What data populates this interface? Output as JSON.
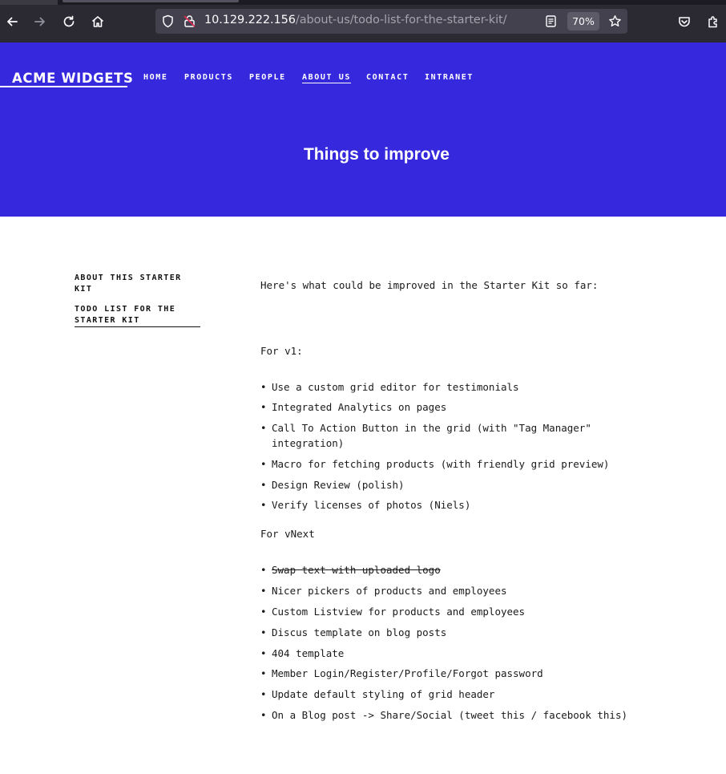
{
  "browser": {
    "url_host": "10.129.222.156",
    "url_path": "/about-us/todo-list-for-the-starter-kit/",
    "zoom": "70%",
    "icons": [
      "back-icon",
      "forward-icon",
      "reload-icon",
      "home-icon",
      "shield-icon",
      "insecure-lock-icon",
      "reader-view-icon",
      "bookmark-star-icon",
      "pocket-icon",
      "extensions-icon"
    ]
  },
  "site": {
    "logo": "ACME WIDGETS",
    "nav": [
      "HOME",
      "PRODUCTS",
      "PEOPLE",
      "ABOUT US",
      "CONTACT",
      "INTRANET"
    ],
    "active_nav": "ABOUT US",
    "page_title": "Things to improve",
    "brand_color": "#3628dd"
  },
  "sidebar": {
    "items": [
      {
        "label": "ABOUT THIS STARTER KIT",
        "active": false
      },
      {
        "label": "TODO LIST FOR THE STARTER KIT",
        "active": true
      }
    ]
  },
  "content": {
    "intro": "Here's what could be improved in the Starter Kit so far:",
    "v1_heading": "For v1:",
    "v1_items": [
      {
        "text": "Use a custom grid editor for testimonials",
        "done": false
      },
      {
        "text": "Integrated Analytics on pages",
        "done": false
      },
      {
        "text": "Call To Action Button in the grid (with \"Tag Manager\" integration)",
        "done": false
      },
      {
        "text": "Macro for fetching products (with friendly grid preview)",
        "done": false
      },
      {
        "text": "Design Review (polish)",
        "done": false
      },
      {
        "text": "Verify licenses of photos (Niels)",
        "done": false
      }
    ],
    "vnext_heading": "For vNext",
    "vnext_items": [
      {
        "text": "Swap text with uploaded logo",
        "done": true
      },
      {
        "text": "Nicer pickers of products and employees",
        "done": false
      },
      {
        "text": "Custom Listview for products and employees",
        "done": false
      },
      {
        "text": "Discus template on blog posts",
        "done": false
      },
      {
        "text": "404 template",
        "done": false
      },
      {
        "text": "Member Login/Register/Profile/Forgot password",
        "done": false
      },
      {
        "text": "Update default styling of grid header",
        "done": false
      },
      {
        "text": "On a Blog post -> Share/Social (tweet this / facebook this)",
        "done": false
      }
    ]
  }
}
